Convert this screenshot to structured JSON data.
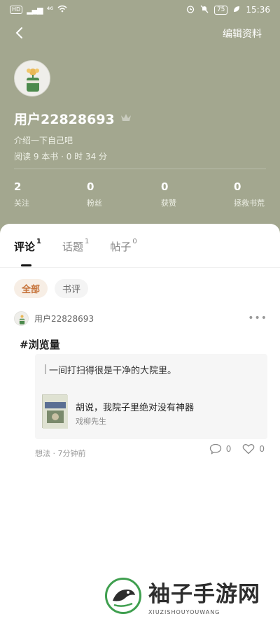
{
  "status_bar": {
    "hd": "HD",
    "network": "⁴⁶",
    "battery": "75",
    "time": "15:36"
  },
  "header": {
    "back_icon": "chevron-left-icon",
    "edit_label": "编辑资料",
    "username": "用户22828693",
    "intro": "介绍一下自己吧",
    "reading_info": "阅读 9 本书 · 0 时 34 分",
    "bg_color": "#a3a78f",
    "stats": [
      {
        "value": "2",
        "label": "关注"
      },
      {
        "value": "0",
        "label": "粉丝"
      },
      {
        "value": "0",
        "label": "获赞"
      },
      {
        "value": "0",
        "label": "拯救书荒"
      }
    ]
  },
  "tabs": [
    {
      "label": "评论",
      "count": "1"
    },
    {
      "label": "话题",
      "count": "1"
    },
    {
      "label": "帖子",
      "count": "0"
    }
  ],
  "filters": [
    "全部",
    "书评"
  ],
  "post": {
    "username": "用户22828693",
    "more": "•••",
    "title": "#浏览量",
    "quote": "一间打扫得很是干净的大院里。",
    "book_title": "胡说，我院子里绝对没有神器",
    "book_author": "戏柳先生",
    "meta": "想法 · 7分钟前",
    "comment_count": "0",
    "like_count": "0"
  },
  "watermark": {
    "cn": "袖子手游网",
    "en": "XIUZISHOUYOUWANG"
  }
}
